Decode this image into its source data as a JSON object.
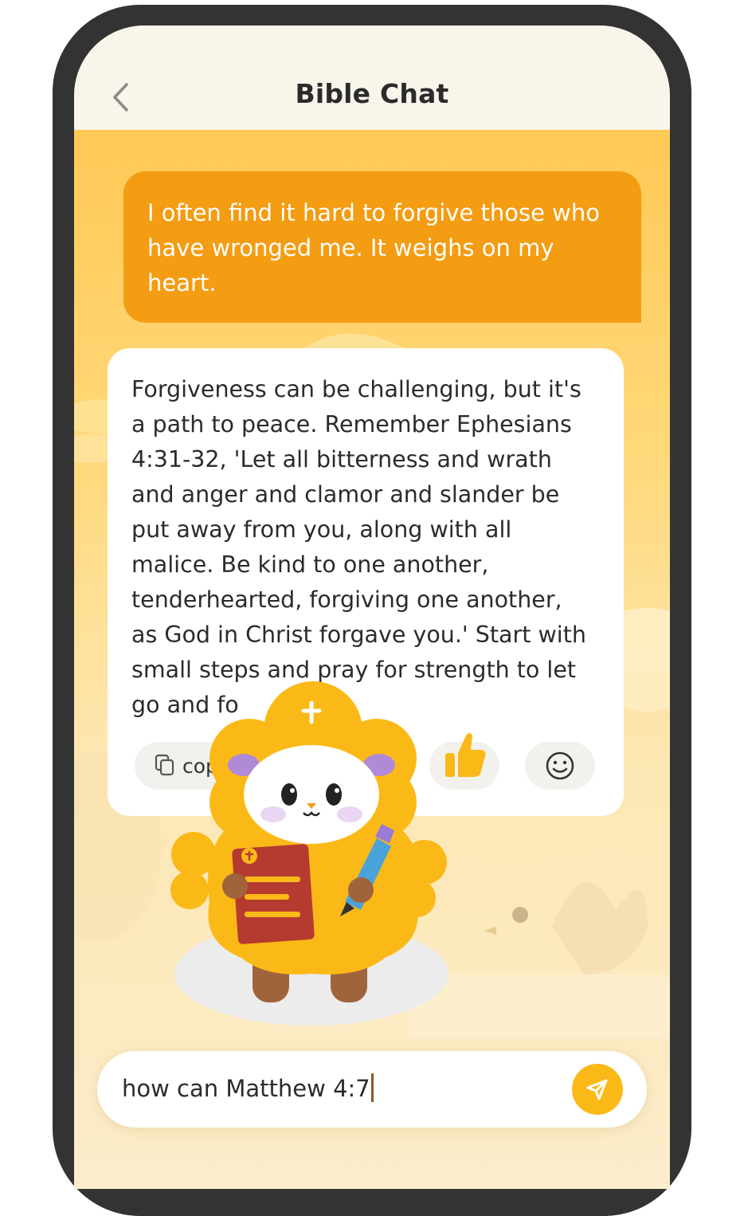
{
  "header": {
    "title": "Bible Chat",
    "back_icon": "chevron-left-icon"
  },
  "messages": {
    "user": "I often find it hard to forgive those who have wronged me. It weighs on my heart.",
    "bot": "Forgiveness can be challenging, but it's\n a path to peace. Remember Ephesians\n4:31-32, 'Let all bitterness and wrath\nand anger and clamor and slander be\nput away from you, along with all\nmalice. Be kind to one another,\ntenderhearted, forgiving one another,\nas God in Christ forgave you.' Start with\n small steps and pray for strength to let\n go and fo"
  },
  "actions": {
    "copy_label": "cop",
    "copy_icon": "copy-icon",
    "like_icon": "thumbs-up-icon",
    "emoji_icon": "smiley-icon"
  },
  "input": {
    "value": "how can Matthew 4:7",
    "send_icon": "send-icon"
  },
  "colors": {
    "accent": "#f49c12",
    "send_button": "#fbb918",
    "background_top": "#ffc955",
    "frame": "#333333"
  }
}
